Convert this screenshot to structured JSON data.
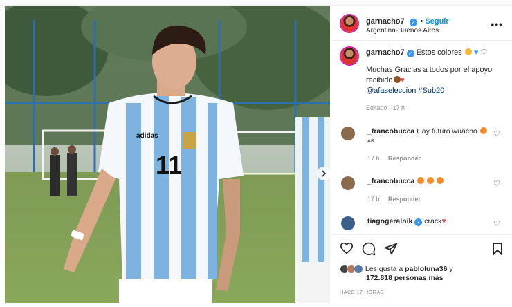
{
  "post": {
    "username": "garnacho7",
    "follow_label": "Seguir",
    "location": "Argentina-Buenos Aires",
    "more_label": "•••"
  },
  "caption": {
    "username": "garnacho7",
    "line1": "Estos colores",
    "line2": "Muchas Gracias a todos por el apoyo",
    "line3": "recibido",
    "tags": "@afaseleccion #Sub20",
    "edited": "Editado · 17 h"
  },
  "comments": [
    {
      "username": "_francobucca",
      "text": "Hay futuro wuacho",
      "meta": "AR",
      "time": "17 h",
      "reply": "Responder"
    },
    {
      "username": "_francobucca",
      "text": "",
      "time": "17 h",
      "reply": "Responder"
    },
    {
      "username": "tiagogeralnik",
      "text": "crack"
    }
  ],
  "likes": {
    "prefix": "Les gusta a",
    "user": "pabloluna36",
    "conj": "y",
    "others": "172.818 personas más"
  },
  "timestamp": "HACE 17 HORAS",
  "jersey_number": "11",
  "colors": {
    "follow": "#0095f6",
    "verified": "#3897f0",
    "link": "#00376b",
    "muted": "#8e8e8e",
    "heart_red": "#ed4956"
  }
}
